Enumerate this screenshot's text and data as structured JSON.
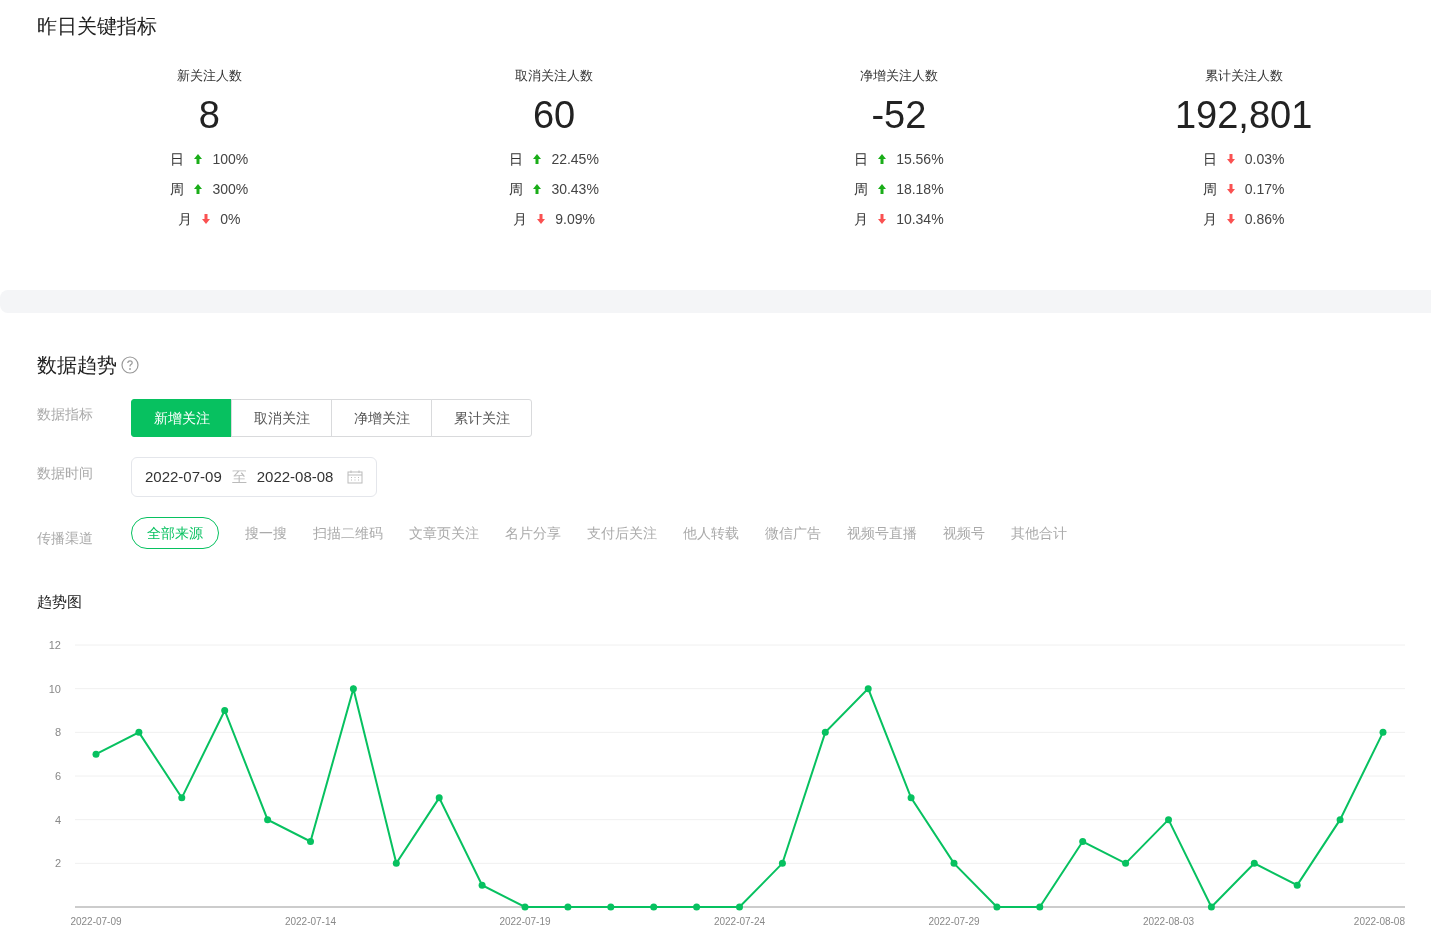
{
  "key_metrics": {
    "title": "昨日关键指标",
    "items": [
      {
        "label": "新关注人数",
        "value": "8",
        "changes": [
          {
            "period": "日",
            "rising": true,
            "value": "100%"
          },
          {
            "period": "周",
            "rising": true,
            "value": "300%"
          },
          {
            "period": "月",
            "rising": false,
            "value": "0%"
          }
        ]
      },
      {
        "label": "取消关注人数",
        "value": "60",
        "changes": [
          {
            "period": "日",
            "rising": true,
            "value": "22.45%"
          },
          {
            "period": "周",
            "rising": true,
            "value": "30.43%"
          },
          {
            "period": "月",
            "rising": false,
            "value": "9.09%"
          }
        ]
      },
      {
        "label": "净增关注人数",
        "value": "-52",
        "changes": [
          {
            "period": "日",
            "rising": true,
            "value": "15.56%"
          },
          {
            "period": "周",
            "rising": true,
            "value": "18.18%"
          },
          {
            "period": "月",
            "rising": false,
            "value": "10.34%"
          }
        ]
      },
      {
        "label": "累计关注人数",
        "value": "192,801",
        "changes": [
          {
            "period": "日",
            "rising": false,
            "value": "0.03%"
          },
          {
            "period": "周",
            "rising": false,
            "value": "0.17%"
          },
          {
            "period": "月",
            "rising": false,
            "value": "0.86%"
          }
        ]
      }
    ]
  },
  "trend": {
    "title": "数据趋势",
    "metric_label": "数据指标",
    "metric_tabs": [
      {
        "label": "新增关注",
        "selected": true
      },
      {
        "label": "取消关注",
        "selected": false
      },
      {
        "label": "净增关注",
        "selected": false
      },
      {
        "label": "累计关注",
        "selected": false
      }
    ],
    "time_label": "数据时间",
    "date_range": {
      "start": "2022-07-09",
      "separator": "至",
      "end": "2022-08-08"
    },
    "channel_label": "传播渠道",
    "channels": [
      {
        "label": "全部来源",
        "selected": true
      },
      {
        "label": "搜一搜",
        "selected": false
      },
      {
        "label": "扫描二维码",
        "selected": false
      },
      {
        "label": "文章页关注",
        "selected": false
      },
      {
        "label": "名片分享",
        "selected": false
      },
      {
        "label": "支付后关注",
        "selected": false
      },
      {
        "label": "他人转载",
        "selected": false
      },
      {
        "label": "微信广告",
        "selected": false
      },
      {
        "label": "视频号直播",
        "selected": false
      },
      {
        "label": "视频号",
        "selected": false
      },
      {
        "label": "其他合计",
        "selected": false
      }
    ],
    "chart_title": "趋势图",
    "chart_data": {
      "type": "line",
      "ylim": [
        0,
        12
      ],
      "yticks": [
        2,
        4,
        6,
        8,
        10,
        12
      ],
      "grid": true,
      "categories": [
        "2022-07-09",
        null,
        null,
        null,
        null,
        "2022-07-14",
        null,
        null,
        null,
        null,
        "2022-07-19",
        null,
        null,
        null,
        null,
        "2022-07-24",
        null,
        null,
        null,
        null,
        "2022-07-29",
        null,
        null,
        null,
        null,
        "2022-08-03",
        null,
        null,
        null,
        null,
        "2022-08-08"
      ],
      "series": [
        {
          "color": "#07c160",
          "marker": true,
          "values": [
            7,
            8,
            5,
            9,
            4,
            3,
            10,
            2,
            5,
            1,
            0,
            0,
            0,
            0,
            0,
            0,
            2,
            8,
            10,
            5,
            2,
            0,
            0,
            3,
            2,
            4,
            0,
            2,
            1,
            4,
            8
          ]
        }
      ]
    }
  }
}
